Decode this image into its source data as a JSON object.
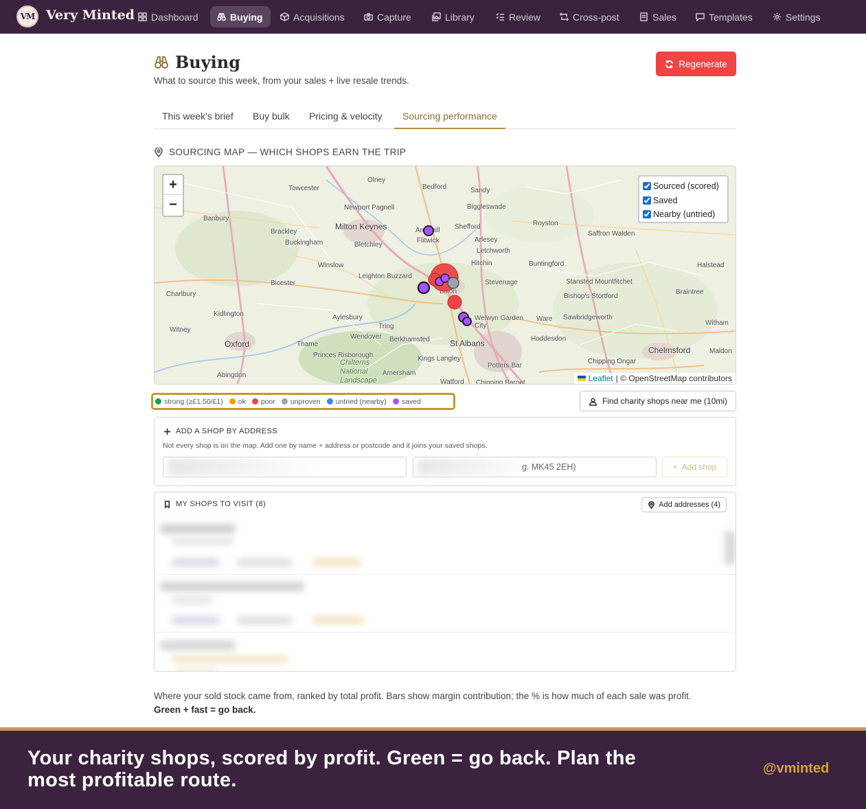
{
  "brand": {
    "logo": "VM",
    "name": "Very Minted"
  },
  "nav": [
    {
      "label": "Dashboard",
      "icon": "grid-icon"
    },
    {
      "label": "Buying",
      "icon": "binoculars-icon",
      "active": true
    },
    {
      "label": "Acquisitions",
      "icon": "box-icon"
    },
    {
      "label": "Capture",
      "icon": "camera-icon"
    },
    {
      "label": "Library",
      "icon": "images-icon"
    },
    {
      "label": "Review",
      "icon": "checklist-icon"
    },
    {
      "label": "Cross-post",
      "icon": "repeat-icon"
    },
    {
      "label": "Sales",
      "icon": "receipt-icon"
    },
    {
      "label": "Templates",
      "icon": "message-icon"
    },
    {
      "label": "Settings",
      "icon": "gear-icon"
    }
  ],
  "header": {
    "title": "Buying",
    "subtitle": "What to source this week, from your sales + live resale trends.",
    "regenerate_label": "Regenerate"
  },
  "tabs": [
    {
      "label": "This week's brief"
    },
    {
      "label": "Buy bulk"
    },
    {
      "label": "Pricing & velocity"
    },
    {
      "label": "Sourcing performance",
      "active": true
    }
  ],
  "map_section": {
    "heading": "SOURCING MAP — WHICH SHOPS EARN THE TRIP",
    "zoom_in": "+",
    "zoom_out": "−",
    "layers": [
      {
        "label": "Sourced (scored)",
        "checked": true
      },
      {
        "label": "Saved",
        "checked": true
      },
      {
        "label": "Nearby (untried)",
        "checked": true
      }
    ],
    "attribution_leaflet": "Leaflet",
    "attribution_osm": "| © OpenStreetMap contributors",
    "places": [
      "Olney",
      "Bedford",
      "Sandy",
      "Towcester",
      "Newport Pagnell",
      "Biggleswade",
      "Banbury",
      "Milton Keynes",
      "Ampthill",
      "Shefford",
      "Royston",
      "Brackley",
      "Flitwick",
      "Arlesey",
      "Saffron Walden",
      "Buckingham",
      "Bletchley",
      "Letchworth",
      "Hitchin",
      "Winslow",
      "Buntingford",
      "Halstead",
      "Leighton Buzzard",
      "Stevenage",
      "Stansted Mountfitchet",
      "Bicester",
      "Luton",
      "Bishop's Stortford",
      "Braintree",
      "Charlbury",
      "Kidlington",
      "Aylesbury",
      "Welwyn Garden City",
      "Ware",
      "Sawbridgeworth",
      "Tring",
      "Witham",
      "Witney",
      "Wendover",
      "Berkhamsted",
      "St Albans",
      "Hoddesdon",
      "Oxford",
      "Thame",
      "Chelmsford",
      "Maldon",
      "Princes Risborough",
      "Chilterns National Landscape",
      "Kings Langley",
      "Potters Bar",
      "Chipping Ongar",
      "Abingdon",
      "Amersham",
      "Watford",
      "Chipping Barnet"
    ],
    "markers": [
      {
        "kind": "saved",
        "label": "Ampthill shop"
      },
      {
        "kind": "poor",
        "label": "Luton cluster"
      },
      {
        "kind": "saved",
        "label": "Luton saved"
      },
      {
        "kind": "unproven",
        "label": "Luton unproven"
      },
      {
        "kind": "saved",
        "label": "Dunstable saved"
      },
      {
        "kind": "poor",
        "label": "Harpenden"
      },
      {
        "kind": "saved",
        "label": "Welwyn saved"
      }
    ]
  },
  "legend": [
    {
      "label": "strong (≥£1.50/£1)",
      "color": "#16a34a"
    },
    {
      "label": "ok",
      "color": "#f59e0b"
    },
    {
      "label": "poor",
      "color": "#ef4444"
    },
    {
      "label": "unproven",
      "color": "#9ca3af"
    },
    {
      "label": "untried (nearby)",
      "color": "#3b82f6"
    },
    {
      "label": "saved",
      "color": "#a855f7"
    }
  ],
  "find_button_label": "Find charity shops near me (10mi)",
  "add_shop": {
    "heading": "ADD A SHOP BY ADDRESS",
    "description": "Not every shop is on the map. Add one by name + address or postcode and it joins your saved shops.",
    "name_value": "",
    "postcode_placeholder": "g. MK45 2EH)",
    "button_label": "Add shop"
  },
  "shops_card": {
    "heading": "MY SHOPS TO VISIT (8)",
    "add_addresses_label": "Add addresses (4)"
  },
  "footer_text": {
    "main": "Where your sold stock came from, ranked by total profit. Bars show margin contribution; the % is how much of each sale was profit.",
    "bold": "Green + fast = go back."
  },
  "banner": {
    "text": "Your charity shops, scored by profit. Green = go back. Plan the most profitable route.",
    "handle": "@vminted"
  }
}
